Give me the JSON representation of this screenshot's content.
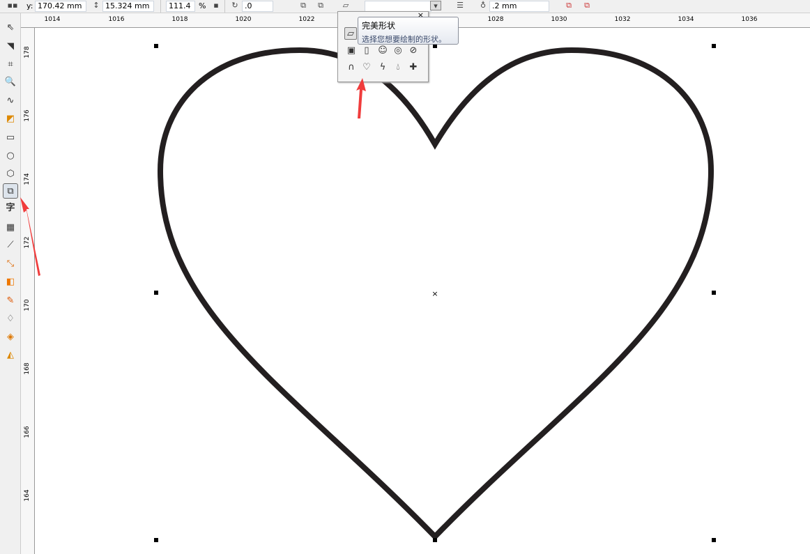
{
  "toolbar": {
    "y_label": "y:",
    "y_value": "170.42 mm",
    "height_value": "15.324 mm",
    "scale_value": "111.4",
    "scale_unit": "%",
    "rotation_value": ".0",
    "outline_width": ".2 mm"
  },
  "ruler": {
    "h_labels": [
      "1014",
      "1016",
      "1018",
      "1020",
      "1022",
      "1028",
      "1030",
      "1032",
      "1034",
      "1036"
    ],
    "v_labels": [
      "178",
      "176",
      "174",
      "172",
      "170",
      "168",
      "166",
      "164"
    ]
  },
  "toolbox": {
    "tools": [
      "pick-tool",
      "shape-tool",
      "crop-tool",
      "zoom-tool",
      "freehand-tool",
      "smart-fill-tool",
      "rectangle-tool",
      "ellipse-tool",
      "polygon-tool",
      "basic-shapes-tool",
      "text-tool",
      "table-tool",
      "dimension-tool",
      "connector-tool",
      "blend-tool",
      "eyedropper-tool",
      "outline-tool",
      "fill-tool",
      "interactive-fill-tool"
    ],
    "active": "basic-shapes-tool",
    "text_tool_glyph": "字"
  },
  "popup": {
    "close": "×",
    "shapes": [
      "parallelogram",
      "frame",
      "folded-corner",
      "smiley",
      "ring",
      "no-symbol",
      "arch",
      "heart",
      "lightning",
      "teardrop",
      "plaque"
    ]
  },
  "tooltip": {
    "title": "完美形状",
    "description": "选择您想要绘制的形状。"
  },
  "colors": {
    "heart_outline": "#231f20",
    "arrow": "#f03c3c"
  }
}
